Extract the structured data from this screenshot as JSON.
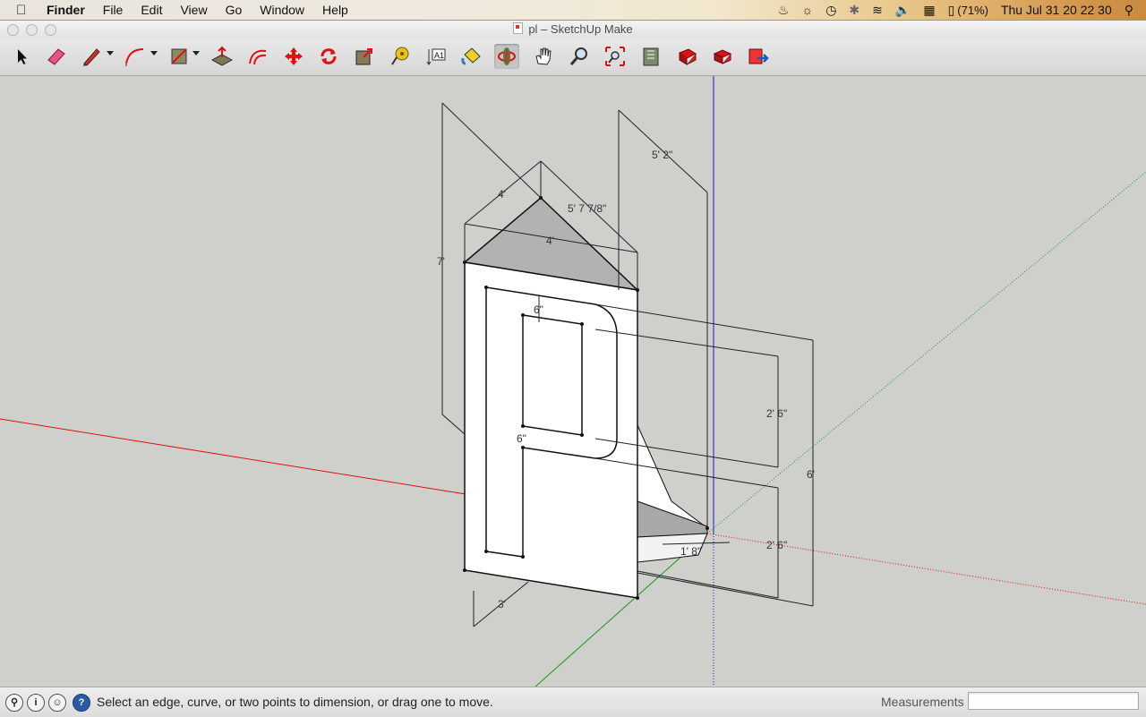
{
  "menubar": {
    "app_name": "Finder",
    "menus": [
      "File",
      "Edit",
      "View",
      "Go",
      "Window",
      "Help"
    ],
    "battery": "(71%)",
    "clock": "Thu Jul 31  20 22 30"
  },
  "window": {
    "title": "pl – SketchUp Make"
  },
  "toolbar": {
    "tools": [
      {
        "name": "select-tool-icon"
      },
      {
        "name": "eraser-tool-icon"
      },
      {
        "name": "pencil-line-tool-icon"
      },
      {
        "name": "arc-tool-icon"
      },
      {
        "name": "rectangle-tool-icon"
      },
      {
        "name": "push-pull-tool-icon"
      },
      {
        "name": "offset-tool-icon"
      },
      {
        "name": "move-tool-icon"
      },
      {
        "name": "rotate-tool-icon"
      },
      {
        "name": "scale-tool-icon"
      },
      {
        "name": "tape-measure-tool-icon"
      },
      {
        "name": "dimension-tool-icon"
      },
      {
        "name": "paint-bucket-tool-icon"
      },
      {
        "name": "orbit-tool-icon"
      },
      {
        "name": "pan-tool-icon"
      },
      {
        "name": "zoom-tool-icon"
      },
      {
        "name": "zoom-extents-tool-icon"
      },
      {
        "name": "3d-warehouse-icon"
      },
      {
        "name": "share-model-icon"
      },
      {
        "name": "extension-warehouse-icon"
      },
      {
        "name": "export-icon"
      }
    ]
  },
  "model": {
    "dimensions": {
      "height_total": "7'",
      "width_top_a": "4'",
      "width_top_b": "4'",
      "diag": "5' 7 7/8\"",
      "depth": "5' 2\"",
      "panel_top_offset": "6\"",
      "panel_mid_offset": "6\"",
      "upper_height": "2' 6\"",
      "lower_height": "2' 6\"",
      "right_total": "6'",
      "bottom_width": "3'",
      "small": "1' 8\""
    }
  },
  "statusbar": {
    "message": "Select an edge, curve, or two points to dimension, or drag one to move.",
    "measurements_label": "Measurements",
    "measurements_value": ""
  }
}
